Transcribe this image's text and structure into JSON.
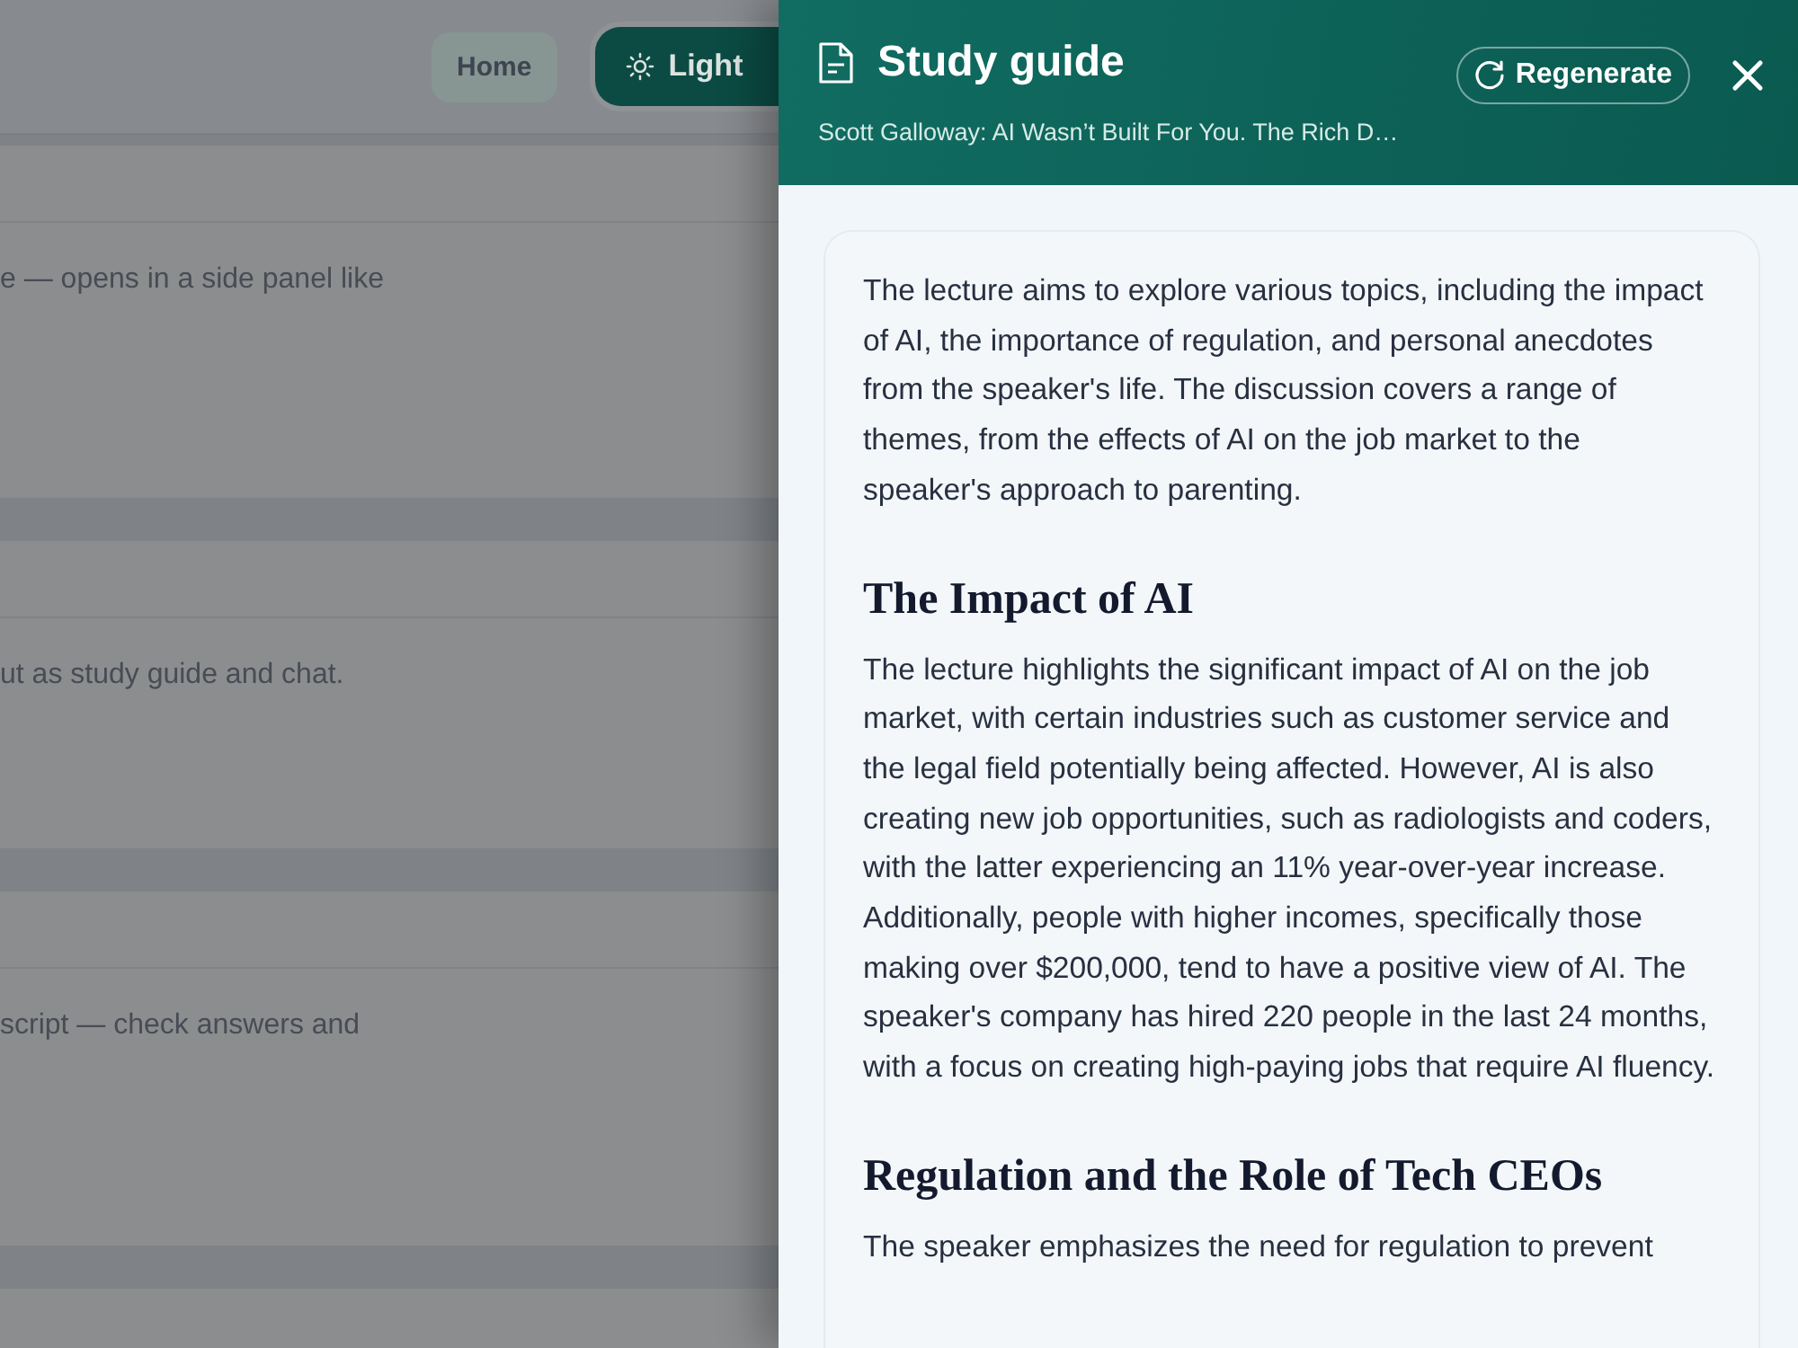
{
  "header": {
    "home_button": "Home",
    "theme_button": "Light"
  },
  "background_cards": [
    {
      "text": "e — opens in a side panel like"
    },
    {
      "text": "ut as study guide and chat."
    },
    {
      "text": "script — check answers and"
    }
  ],
  "panel": {
    "title": "Study guide",
    "subtitle": "Scott Galloway: AI Wasn’t Built For You. The Rich D…",
    "regenerate_button": "Regenerate",
    "content": [
      {
        "kind": "paragraph",
        "text": "The lecture aims to explore various topics, including the impact of AI, the importance of regulation, and personal anecdotes from the speaker's life. The discussion covers a range of themes, from the effects of AI on the job market to the speaker's approach to parenting."
      },
      {
        "kind": "heading",
        "text": "The Impact of AI"
      },
      {
        "kind": "paragraph",
        "text": "The lecture highlights the significant impact of AI on the job market, with certain industries such as customer service and the legal field potentially being affected. However, AI is also creating new job opportunities, such as radiologists and coders, with the latter experiencing an 11% year-over-year increase. Additionally, people with higher incomes, specifically those making over $200,000, tend to have a positive view of AI. The speaker's company has hired 220 people in the last 24 months, with a focus on creating high-paying jobs that require AI fluency."
      },
      {
        "kind": "heading",
        "text": "Regulation and the Role of Tech CEOs"
      },
      {
        "kind": "paragraph",
        "text": "The speaker emphasizes the need for regulation to prevent"
      }
    ]
  }
}
